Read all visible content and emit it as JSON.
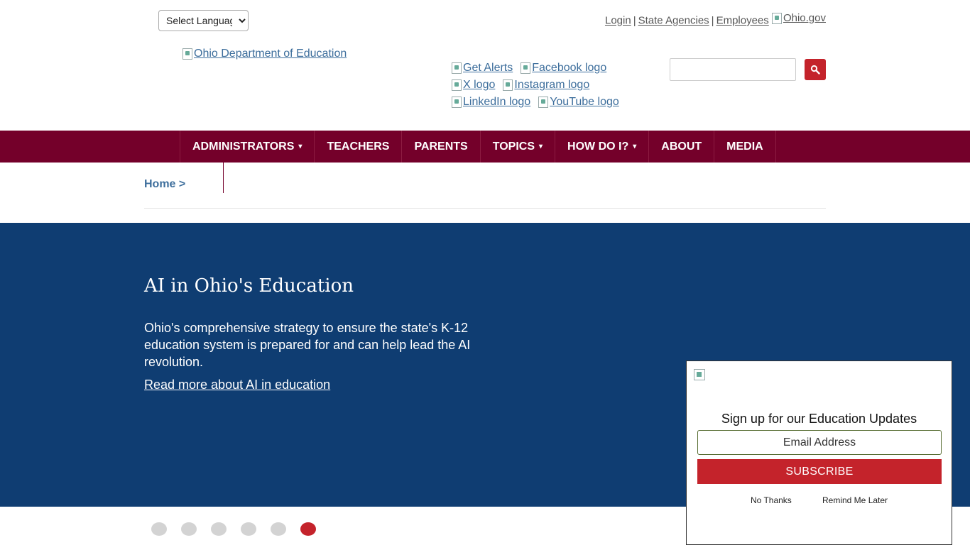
{
  "top": {
    "language_select": "Select Language",
    "links": [
      {
        "label": "Login"
      },
      {
        "label": "State Agencies"
      },
      {
        "label": "Employees"
      }
    ],
    "separator": "|",
    "ohio_gov_alt": "Ohio.gov"
  },
  "header": {
    "logo_alt": "Ohio Department of Education",
    "social": [
      {
        "alt": "Get Alerts"
      },
      {
        "alt": "Facebook logo"
      },
      {
        "alt": "X logo"
      },
      {
        "alt": "Instagram logo"
      },
      {
        "alt": "LinkedIn logo"
      },
      {
        "alt": "YouTube logo"
      }
    ],
    "search_icon": "search-icon"
  },
  "nav": {
    "items": [
      {
        "label": "ADMINISTRATORS",
        "caret": "▾"
      },
      {
        "label": "TEACHERS"
      },
      {
        "label": "PARENTS"
      },
      {
        "label": "TOPICS",
        "caret": "▾"
      },
      {
        "label": "HOW DO I?",
        "caret": "▾"
      },
      {
        "label": "ABOUT"
      },
      {
        "label": "MEDIA"
      }
    ]
  },
  "breadcrumb": {
    "home": "Home >"
  },
  "hero": {
    "title": "AI in Ohio's Education",
    "text": "Ohio's comprehensive strategy to ensure the state's K-12 education system is prepared for and can help lead the AI revolution.",
    "link": "Read more about AI in education",
    "slides_count": 6,
    "active_slide": 6
  },
  "popup": {
    "title": "Sign up for our Education Updates",
    "email_placeholder": "Email Address",
    "subscribe": "SUBSCRIBE",
    "no_thanks": "No Thanks",
    "remind_later": "Remind Me Later"
  },
  "colors": {
    "nav_bg": "#74002a",
    "hero_bg": "#0f3d72",
    "accent_red": "#c4232b",
    "link_blue": "#3d6e9c"
  }
}
